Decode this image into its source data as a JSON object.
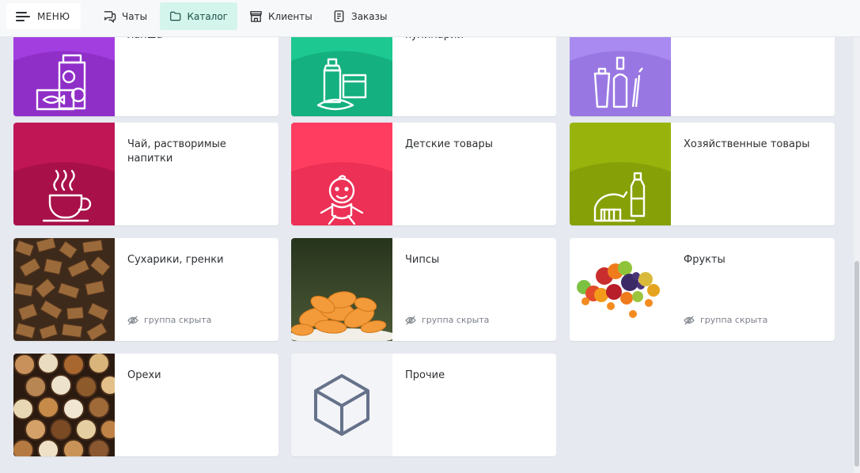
{
  "topbar": {
    "menu_label": "МЕНЮ",
    "tabs": [
      {
        "label": "Чаты",
        "icon": "chat-bubbles-icon"
      },
      {
        "label": "Каталог",
        "icon": "folder-icon",
        "active": true
      },
      {
        "label": "Клиенты",
        "icon": "store-icon"
      },
      {
        "label": "Заказы",
        "icon": "document-icon"
      }
    ]
  },
  "hidden_label": "группа скрыта",
  "colors": {
    "accent_active_tab": "#d3f5ec",
    "purple": "#9b3fd4",
    "green": "#1cc08f",
    "lavender": "#9f7fe6",
    "crimson": "#b81452",
    "pink": "#ff3d61",
    "olive": "#97b40b"
  },
  "cards": [
    {
      "title": "лапша",
      "icon": "canned-goods-icon",
      "hidden": false
    },
    {
      "title": "кулинарии",
      "icon": "grocery-bottles-icon",
      "hidden": false
    },
    {
      "title": "",
      "icon": "hygiene-products-icon",
      "hidden": false
    },
    {
      "title": "Чай, растворимые напитки",
      "icon": "tea-cup-icon",
      "hidden": false
    },
    {
      "title": "Детские товары",
      "icon": "baby-icon",
      "hidden": false
    },
    {
      "title": "Хозяйственные товары",
      "icon": "cleaning-supplies-icon",
      "hidden": false
    },
    {
      "title": "Сухарики, гренки",
      "icon": "croutons-photo",
      "hidden": true
    },
    {
      "title": "Чипсы",
      "icon": "chips-photo",
      "hidden": true
    },
    {
      "title": "Фрукты",
      "icon": "fruits-photo",
      "hidden": true
    },
    {
      "title": "Орехи",
      "icon": "nuts-photo",
      "hidden": false
    },
    {
      "title": "Прочие",
      "icon": "cube-icon",
      "hidden": false
    }
  ]
}
